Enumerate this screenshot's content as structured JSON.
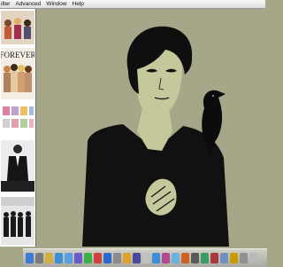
{
  "menubar": {
    "items": [
      "ilter",
      "Advanced",
      "Window",
      "Help"
    ]
  },
  "sidebar": {
    "thumbnails": [
      {
        "name": "group-photo-thumbnail"
      },
      {
        "name": "forever-album-cover-thumbnail",
        "text": "FOREVER"
      },
      {
        "name": "pink-album-grid-thumbnail"
      },
      {
        "name": "man-in-suit-thumbnail"
      },
      {
        "name": "band-photo-thumbnail"
      }
    ]
  },
  "wallpaper": {
    "description_colors": {
      "background": "#a6a688",
      "skin": "#c4c89a",
      "dark": "#0f0f0f"
    }
  },
  "dock": {
    "icons": [
      "finder-icon",
      "app-icon",
      "app-icon",
      "safari-icon",
      "mail-icon",
      "itunes-icon",
      "ichat-icon",
      "app-icon",
      "app-icon",
      "app-icon",
      "app-icon",
      "app-icon",
      "app-icon",
      "app-icon",
      "app-icon",
      "app-icon",
      "app-icon",
      "app-icon",
      "app-icon",
      "app-icon",
      "app-icon",
      "app-icon",
      "app-icon",
      "trash-icon"
    ],
    "colors": [
      "#3b7bd6",
      "#7a7a7a",
      "#d0b040",
      "#3a8fd8",
      "#5aa0e0",
      "#6a5acd",
      "#3cb043",
      "#d04040",
      "#2a6ad0",
      "#8a8a8a",
      "#e0a030",
      "#4a4a9a",
      "#c0c0c0",
      "#3a8fd8",
      "#b04a90",
      "#6ab0e0",
      "#d06020",
      "#5a5a5a",
      "#3a9a6a",
      "#aa3a3a",
      "#7090c0",
      "#cc9900",
      "#909090",
      "#b8b8b8"
    ]
  }
}
